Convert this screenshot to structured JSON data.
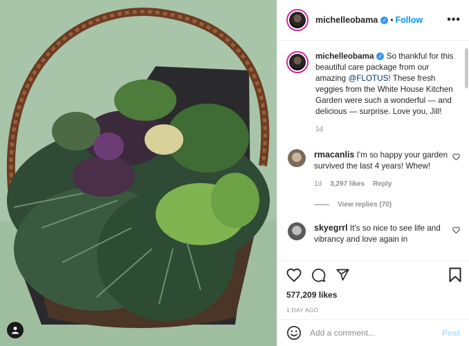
{
  "post": {
    "username": "michelleobama",
    "verified_glyph": "✓",
    "separator": "•",
    "follow_label": "Follow",
    "more_glyph": "•••"
  },
  "caption": {
    "username": "michelleobama",
    "text_before": " So thankful for this beautiful care package from our amazing ",
    "mention": "@FLOTUS",
    "text_after": "! These fresh veggies from the White House Kitchen Garden were such a wonderful — and delicious — surprise. Love you, Jill!",
    "time": "1d"
  },
  "comments": [
    {
      "username": "rmacanlis",
      "text": " I'm so happy your garden survived the last 4 years! Whew!",
      "time": "1d",
      "likes": "3,297 likes",
      "reply": "Reply",
      "view_replies": "View replies (70)"
    },
    {
      "username": "skyegrrl",
      "text": " It's so nice to see life and vibrancy and love again in"
    }
  ],
  "footer": {
    "likes": "577,209 likes",
    "posted": "1 DAY AGO",
    "comment_placeholder": "Add a comment...",
    "post_label": "Post"
  },
  "icons": {
    "like": "heart-icon",
    "comment": "comment-icon",
    "share": "share-icon",
    "save": "bookmark-icon",
    "tag": "user-tag-icon",
    "emoji": "emoji-icon"
  },
  "colors": {
    "accent": "#0095f6",
    "verified": "#3897f0",
    "post_disabled": "#b2dffc",
    "photo_background": "#a9c7ac"
  }
}
